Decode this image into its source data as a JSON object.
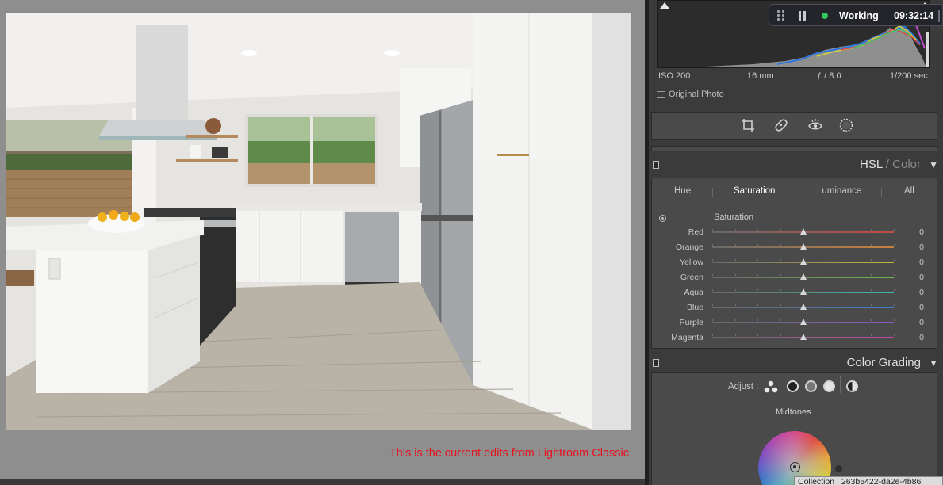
{
  "canvas": {
    "caption": "This is the current edits from Lightroom Classic"
  },
  "histogram": {
    "exif": {
      "iso": "ISO 200",
      "focal": "16 mm",
      "aperture": "ƒ / 8.0",
      "shutter": "1/200 sec"
    },
    "original_photo_label": "Original Photo"
  },
  "tools": [
    "crop-icon",
    "healing-icon",
    "redeye-icon",
    "masking-icon"
  ],
  "hsl": {
    "title": "HSL",
    "title_sep": " / ",
    "title_dim": "Color",
    "tabs": [
      "Hue",
      "Saturation",
      "Luminance",
      "All"
    ],
    "active_tab": "Saturation",
    "subheading": "Saturation",
    "rows": [
      {
        "label": "Red",
        "value": "0",
        "color": "#c44a44"
      },
      {
        "label": "Orange",
        "value": "0",
        "color": "#c9803c"
      },
      {
        "label": "Yellow",
        "value": "0",
        "color": "#c6b83e"
      },
      {
        "label": "Green",
        "value": "0",
        "color": "#6fb54a"
      },
      {
        "label": "Aqua",
        "value": "0",
        "color": "#3fb6a6"
      },
      {
        "label": "Blue",
        "value": "0",
        "color": "#3f7dc7"
      },
      {
        "label": "Purple",
        "value": "0",
        "color": "#8a59c4"
      },
      {
        "label": "Magenta",
        "value": "0",
        "color": "#c04aa6"
      }
    ]
  },
  "color_grading": {
    "title": "Color Grading",
    "adjust_label": "Adjust :",
    "section_label": "Midtones"
  },
  "collection": {
    "text": "Collection : 263b5422-da2e-4b86"
  },
  "recorder": {
    "status": "Working",
    "time": "09:32:14",
    "status_color": "#31c75e"
  }
}
